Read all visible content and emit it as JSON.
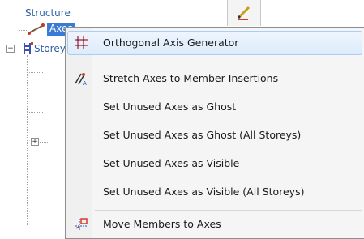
{
  "tree": {
    "root_label": "Structure",
    "axes_label": "Axes",
    "storeys_label": "Storeys"
  },
  "context_menu": {
    "items": [
      {
        "label": "Orthogonal Axis Generator",
        "icon": "grid-icon"
      },
      {
        "label": "Stretch Axes to Member Insertions",
        "icon": "stretch-axes-icon"
      },
      {
        "label": "Set Unused Axes as Ghost",
        "icon": ""
      },
      {
        "label": "Set Unused Axes as Ghost (All Storeys)",
        "icon": ""
      },
      {
        "label": "Set Unused Axes as Visible",
        "icon": ""
      },
      {
        "label": "Set Unused Axes as Visible (All Storeys)",
        "icon": ""
      },
      {
        "label": "Move Members to Axes",
        "icon": "move-members-icon"
      }
    ]
  },
  "colors": {
    "highlight": "#3a7bd5",
    "menu_hover": "#dcebfc",
    "icon_red": "#d43a2a"
  }
}
